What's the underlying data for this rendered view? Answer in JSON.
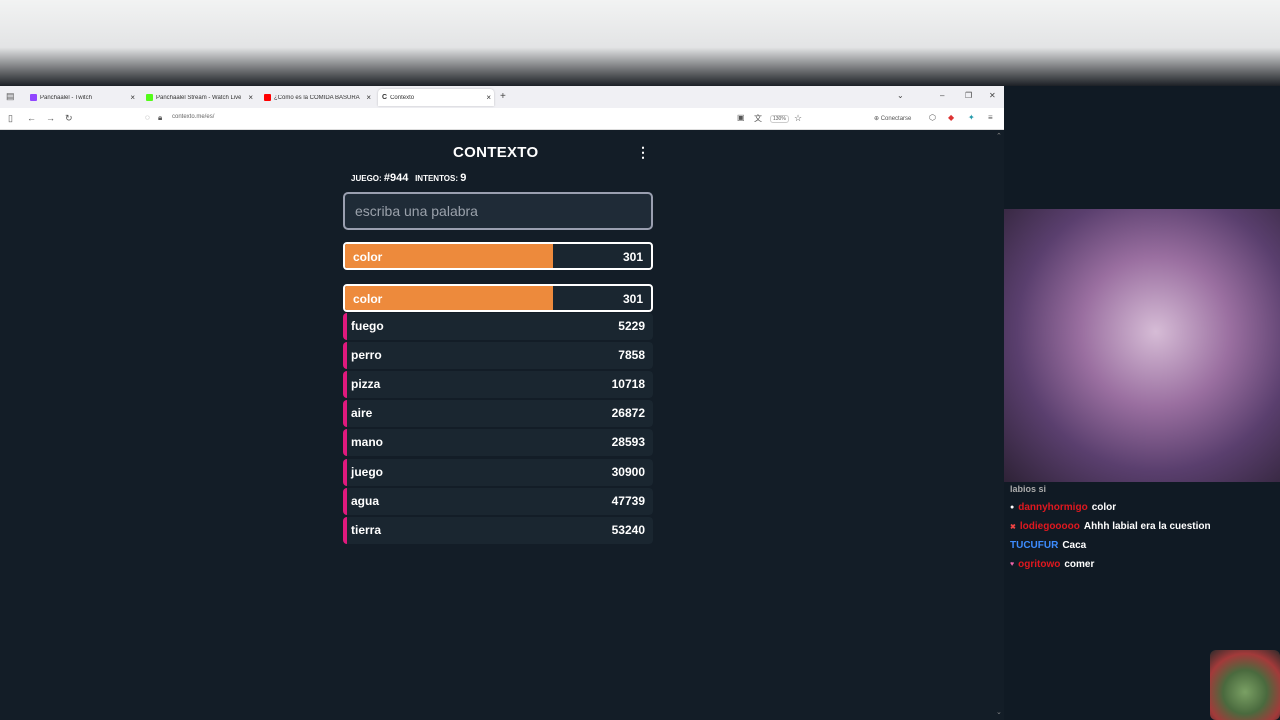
{
  "browser": {
    "tabs": [
      {
        "label": "Panchaalel - Twitch",
        "color": "#9146ff"
      },
      {
        "label": "Panchaalel Stream - Watch Live",
        "color": "#53fc18"
      },
      {
        "label": "¿Cómo es la COMIDA BASURA",
        "color": "#ff0000"
      },
      {
        "label": "Contexto",
        "color": "#333333"
      }
    ],
    "url": "contexto.me/es/",
    "zoom": "130%",
    "connect_label": "Conectarse"
  },
  "game": {
    "brand": "CONTEXTO",
    "game_label": "JUEGO:",
    "game_number": "#944",
    "attempts_label": "INTENTOS:",
    "attempts": "9",
    "input_placeholder": "escriba una palabra",
    "last_guess": {
      "word": "color",
      "rank": "301"
    },
    "guesses": [
      {
        "word": "color",
        "rank": "301",
        "fill": 0.68,
        "color": "#ed8a3c"
      },
      {
        "word": "fuego",
        "rank": "5229",
        "fill": 0.008,
        "color": "#e0197d"
      },
      {
        "word": "perro",
        "rank": "7858",
        "fill": 0.008,
        "color": "#e0197d"
      },
      {
        "word": "pizza",
        "rank": "10718",
        "fill": 0.008,
        "color": "#e0197d"
      },
      {
        "word": "aire",
        "rank": "26872",
        "fill": 0.008,
        "color": "#e0197d"
      },
      {
        "word": "mano",
        "rank": "28593",
        "fill": 0.008,
        "color": "#e0197d"
      },
      {
        "word": "juego",
        "rank": "30900",
        "fill": 0.008,
        "color": "#e0197d"
      },
      {
        "word": "agua",
        "rank": "47739",
        "fill": 0.008,
        "color": "#e0197d"
      },
      {
        "word": "tierra",
        "rank": "53240",
        "fill": 0.008,
        "color": "#e0197d"
      }
    ]
  },
  "chat": {
    "top_line": "labios si",
    "messages": [
      {
        "user": "dannyhormigo",
        "text": "color",
        "color": "#e0181f"
      },
      {
        "user": "lodiegooooo",
        "text": "Ahhh labial era la cuestion",
        "color": "#e0181f"
      },
      {
        "user": "TUCUFUR",
        "text": "Caca",
        "color": "#3d8cff"
      },
      {
        "user": "ogritowo",
        "text": "comer",
        "color": "#e0181f"
      }
    ]
  }
}
